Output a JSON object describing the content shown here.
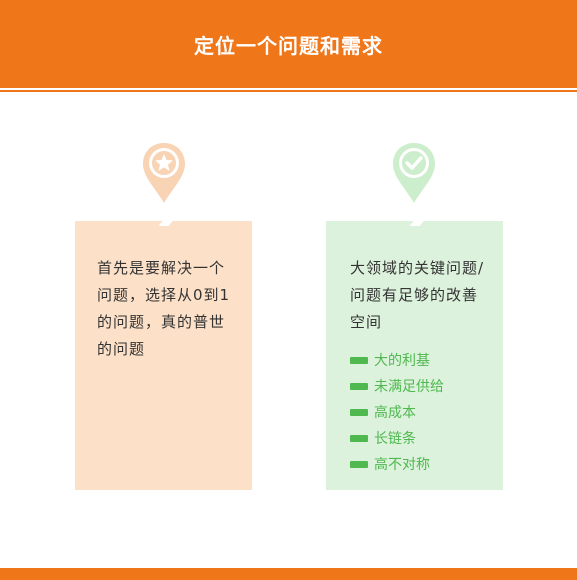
{
  "header": {
    "title": "定位一个问题和需求"
  },
  "colors": {
    "accent": "#f0761a",
    "left_card_bg": "#fce0c7",
    "right_card_bg": "#dcf2dc",
    "green": "#4fb84f",
    "pin_orange": "#f8d3b4",
    "pin_green": "#cdeecd"
  },
  "left_card": {
    "icon": "star-pin-icon",
    "text": "首先是要解决一个问题，选择从0到1的问题，真的普世的问题"
  },
  "right_card": {
    "icon": "check-pin-icon",
    "text": "大领域的关键问题/问题有足够的改善空间",
    "items": [
      "大的利基",
      "未满足供给",
      "高成本",
      "长链条",
      "高不对称"
    ]
  }
}
